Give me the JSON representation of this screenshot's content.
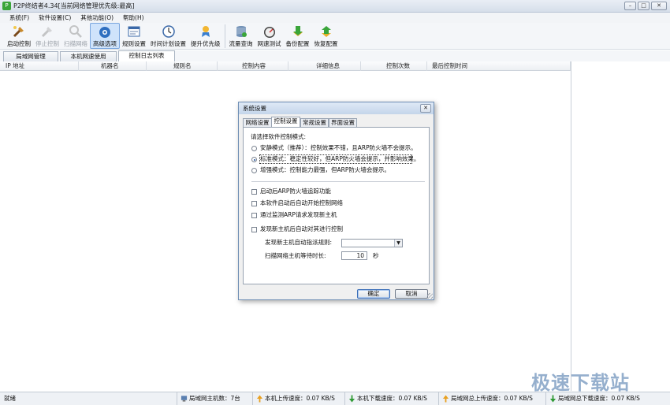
{
  "window": {
    "title": "P2P终结者4.34[当前网络管理优先级:最高]",
    "controls": [
      "–",
      "□",
      "✕"
    ]
  },
  "menu": [
    "系统(F)",
    "软件设置(C)",
    "其他功能(O)",
    "帮助(H)"
  ],
  "toolbar": [
    {
      "label": "启动控制",
      "icon": "start-control-icon",
      "state": "normal"
    },
    {
      "label": "停止控制",
      "icon": "stop-control-icon",
      "state": "disabled"
    },
    {
      "label": "扫描网络",
      "icon": "scan-network-icon",
      "state": "disabled"
    },
    {
      "label": "高级选项",
      "icon": "advanced-options-icon",
      "state": "active"
    },
    {
      "label": "规则设置",
      "icon": "rule-settings-icon",
      "state": "normal"
    },
    {
      "label": "时间计划设置",
      "icon": "time-schedule-icon",
      "state": "normal"
    },
    {
      "label": "提升优先级",
      "icon": "raise-priority-icon",
      "state": "normal"
    },
    {
      "label": "流量查询",
      "icon": "traffic-query-icon",
      "state": "normal"
    },
    {
      "label": "网速测试",
      "icon": "speed-test-icon",
      "state": "normal"
    },
    {
      "label": "备份配置",
      "icon": "backup-config-icon",
      "state": "normal"
    },
    {
      "label": "恢复配置",
      "icon": "restore-config-icon",
      "state": "normal"
    }
  ],
  "tabs": [
    "局域网管理",
    "本机网速使用",
    "控制日志列表"
  ],
  "active_tab": 2,
  "columns": [
    "IP 地址",
    "机器名",
    "规则名",
    "控制内容",
    "详细信息",
    "控制次数",
    "最后控制时间"
  ],
  "dialog": {
    "title": "系统设置",
    "close": "✕",
    "tabs": [
      "网络设置",
      "控制设置",
      "常规设置",
      "界面设置"
    ],
    "active_tab": 1,
    "mode_prompt": "请选择软件控制模式:",
    "modes": [
      {
        "label": "安静模式（推荐）：控制效果不错，且ARP防火墙不会提示。",
        "selected": false
      },
      {
        "label": "标准模式：稳定性较好，但ARP防火墙会提示，并影响效果。",
        "selected": true
      },
      {
        "label": "增强模式：控制能力最强，但ARP防火墙会提示。",
        "selected": false
      }
    ],
    "checkboxes": [
      {
        "label": "启动后ARP防火墙追踪功能",
        "checked": false
      },
      {
        "label": "本软件启动后自动开始控制网络",
        "checked": false
      },
      {
        "label": "通过监测ARP请求发现新主机",
        "checked": false
      },
      {
        "label": "发现新主机后自动对其进行控制",
        "checked": false
      }
    ],
    "rule_label": "发现新主机自动指派规则:",
    "rule_value": "",
    "wait_label": "扫描网络主机等待时长:",
    "wait_value": "10",
    "wait_unit": "秒",
    "ok": "确定",
    "cancel": "取消"
  },
  "status": {
    "ready": "就绪",
    "lan_hosts": "局域网主机数：7台",
    "local_upload": "本机上传速度：0.07 KB/S",
    "local_download": "本机下载速度：0.07 KB/S",
    "lan_upload": "局域网总上传速度：0.07 KB/S",
    "lan_download": "局域网总下载速度：0.07 KB/S"
  },
  "watermark": "极速下载站"
}
